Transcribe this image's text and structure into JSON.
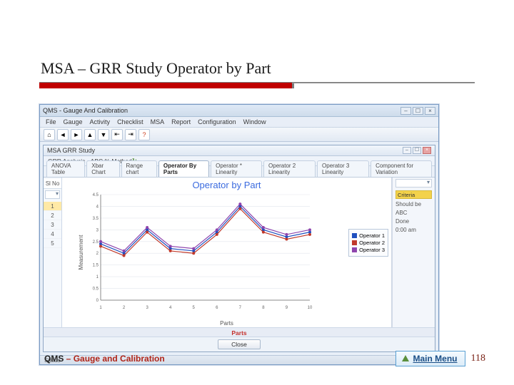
{
  "slide": {
    "title": "MSA – GRR Study Operator by Part"
  },
  "app_window": {
    "title": "QMS - Gauge And Calibration",
    "menu": [
      "File",
      "Gauge",
      "Activity",
      "Checklist",
      "MSA",
      "Report",
      "Configuration",
      "Window"
    ],
    "toolbar_icons": [
      "home-icon",
      "left-icon",
      "right-icon",
      "up-icon",
      "down-icon",
      "first-icon",
      "last-icon",
      "help-icon"
    ]
  },
  "inner_window": {
    "title": "MSA GRR Study",
    "subtitle": "GRR Analysis  •  ABC % Method",
    "tabs": [
      "ANOVA Table",
      "Xbar Chart",
      "Range chart",
      "Operator By Parts",
      "Operator * Linearity",
      "Operator 2 Linearity",
      "Operator 3 Linearity",
      "Component for Variation"
    ],
    "active_tab": 3,
    "sl_header": "Sl No",
    "sl_rows": [
      "1",
      "2",
      "3",
      "4",
      "5"
    ]
  },
  "chart_data": {
    "type": "line",
    "title": "Operator by Part",
    "xlabel": "Parts",
    "ylabel": "Measurement",
    "x": [
      1,
      2,
      3,
      4,
      5,
      6,
      7,
      8,
      9,
      10
    ],
    "ylim": [
      0,
      4.5
    ],
    "yticks": [
      0,
      0.5,
      1,
      1.5,
      2,
      2.5,
      3,
      3.5,
      4,
      4.5
    ],
    "series": [
      {
        "name": "Operator 1",
        "color": "#1f4fbf",
        "values": [
          2.4,
          2.0,
          3.0,
          2.2,
          2.1,
          2.9,
          4.0,
          3.0,
          2.7,
          2.9
        ]
      },
      {
        "name": "Operator 2",
        "color": "#c0392b",
        "values": [
          2.3,
          1.9,
          2.9,
          2.1,
          2.0,
          2.8,
          3.9,
          2.9,
          2.6,
          2.8
        ]
      },
      {
        "name": "Operator 3",
        "color": "#8e44ad",
        "values": [
          2.5,
          2.1,
          3.1,
          2.3,
          2.2,
          3.0,
          4.1,
          3.1,
          2.8,
          3.0
        ]
      }
    ]
  },
  "criteria_panel": {
    "header": "Criteria",
    "rows": {
      "should_be": "Should be",
      "abc": "ABC",
      "done": "Done",
      "time": "0:00 am"
    }
  },
  "buttons": {
    "close": "Close"
  },
  "status": {
    "left": "Status",
    "right": ""
  },
  "footer": {
    "qms": "QMS",
    "sep": " – ",
    "rest": "Gauge and Calibration",
    "main_menu": "Main Menu",
    "page": "118"
  }
}
